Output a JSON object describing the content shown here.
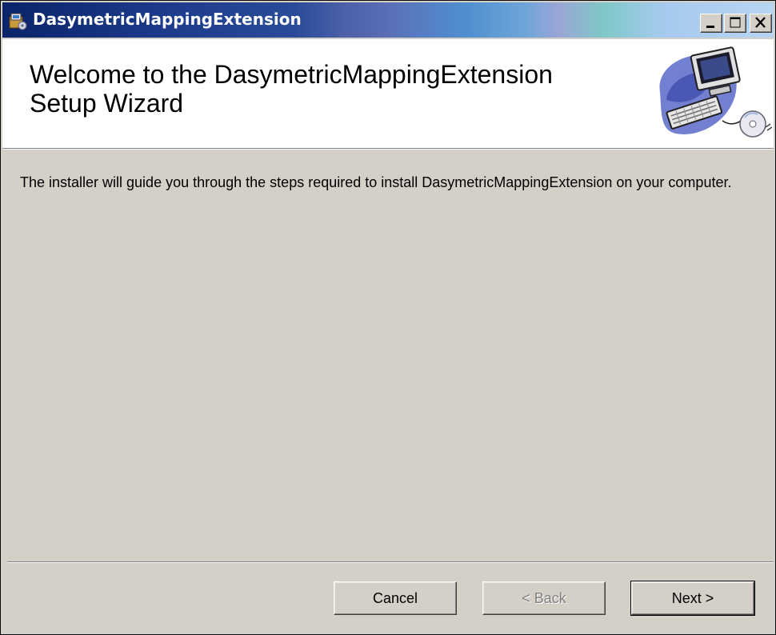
{
  "window": {
    "title": "DasymetricMappingExtension",
    "controls": {
      "minimize": "minimize-icon",
      "maximize": "maximize-icon",
      "close": "close-icon"
    }
  },
  "banner": {
    "title_line1": "Welcome to the DasymetricMappingExtension",
    "title_line2": "Setup Wizard",
    "art": "computer-cd-illustration"
  },
  "body": {
    "intro_text": "The installer will guide you through the steps required to install DasymetricMappingExtension on your computer."
  },
  "buttons": {
    "cancel_label": "Cancel",
    "back_label": "< Back",
    "back_enabled": false,
    "next_label": "Next >"
  },
  "colors": {
    "titlebar_start": "#0a246a",
    "titlebar_end": "#a6caf0",
    "window_face": "#d4d0c8",
    "banner_bg": "#ffffff"
  }
}
